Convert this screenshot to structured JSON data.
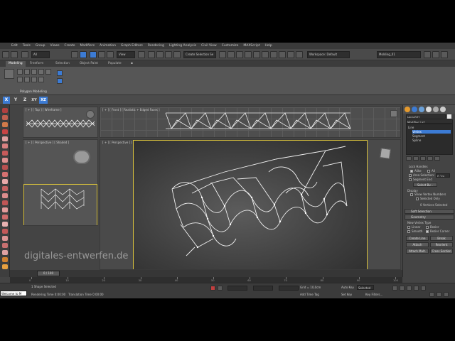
{
  "menu": [
    "Edit",
    "Tools",
    "Group",
    "Views",
    "Create",
    "Modifiers",
    "Animation",
    "Graph Editors",
    "Rendering",
    "Lighting Analysis",
    "Civil View",
    "Customize",
    "MAXScript",
    "Help"
  ],
  "toolbar": {
    "selection_filter": "All",
    "view_dropdown": "View",
    "named_selection": "Create Selection Se",
    "workspace": "Workspace: Default",
    "named_set": "Molding_01"
  },
  "ribbon_tabs": [
    "Modeling",
    "Freeform",
    "Selection",
    "Object Paint",
    "Populate"
  ],
  "ribbon_active_tab": "Modeling",
  "ribbon_panel_label": "Polygon Modeling",
  "axis_buttons": [
    "X",
    "Y",
    "Z",
    "XY",
    "XZ"
  ],
  "viewports": {
    "top": "[ + ] [ Top ] [ Wireframe ]",
    "front": "[ + ] [ Front ] [ Realistic + Edged Faces ]",
    "left": "[ + ] [ Perspective ] [ Shaded ]",
    "main": "[ + ] [ Perspective ] [ Shaded + Edged Faces ]"
  },
  "command_panel": {
    "object_name": "Helix001",
    "modifier_list": "Modifier List",
    "stack": [
      "Line",
      "Vertex",
      "Segment",
      "Spline"
    ],
    "stack_parent": "Line",
    "stack_selected": "Vertex",
    "lock_handles": "Lock Handles",
    "alike": "Alike",
    "all": "All",
    "area_selection": "Area Selection:",
    "area_selection_value": "0.1m",
    "segment_end": "Segment End",
    "select_by": "Select By...",
    "display_header": "Display",
    "show_vertex_numbers": "Show Vertex Numbers",
    "selected_only": "Selected Only",
    "vertices_selected": "0 Vertices Selected",
    "soft_selection": "Soft Selection",
    "geometry": "Geometry",
    "new_vertex_type": "New Vertex Type",
    "linear": "Linear",
    "bezier": "Bezier",
    "smooth": "Smooth",
    "bezier_corner": "Bezier Corner",
    "create_line": "Create Line",
    "break": "Break",
    "attach": "Attach",
    "reorient": "Reorient",
    "attach_mult": "Attach Mult.",
    "cross_section": "Cross Section"
  },
  "timeline": {
    "frame": "0 / 100",
    "ticks": [
      "0",
      "10",
      "20",
      "30",
      "40",
      "50",
      "60",
      "70",
      "80",
      "90",
      "100"
    ]
  },
  "status": {
    "maxscript": "Welcome to M",
    "selected": "1 Shape Selected",
    "rendering_time": "Rendering Time 0:00:00",
    "translation_time": "Translation Time 0:00:00",
    "grid": "Grid = 10,0cm",
    "add_time_tag": "Add Time Tag",
    "auto_key": "Auto Key",
    "set_key": "Set Key",
    "selected_label": "Selected",
    "key_filters": "Key Filters..."
  },
  "watermark": "digitales-entwerfen.de",
  "colors": {
    "accent": "#3c7bd4",
    "active_viewport": "#d8c13c"
  }
}
